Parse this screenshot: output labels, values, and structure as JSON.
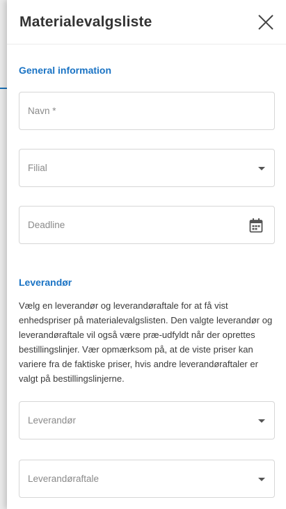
{
  "panel": {
    "title": "Materialevalgsliste",
    "close_icon": "close-icon"
  },
  "general": {
    "heading": "General information",
    "name_placeholder": "Navn *",
    "branch_placeholder": "Filial",
    "deadline_placeholder": "Deadline"
  },
  "supplier": {
    "heading": "Leverandør",
    "description": "Vælg en leverandør og leverandøraftale for at få vist enhedspriser på materialevalgslisten. Den valgte leverandør og leverandøraftale vil også være præ-udfyldt når der oprettes bestillingslinjer. Vær opmærksom på, at de viste priser kan variere fra de faktiske priser, hvis andre leverandøraftaler er valgt på bestillingslinjerne.",
    "supplier_placeholder": "Leverandør",
    "agreement_placeholder": "Leverandøraftale"
  },
  "colors": {
    "accent": "#1a73c4",
    "border": "#d6d6d6",
    "placeholder": "#8a8a8a"
  }
}
